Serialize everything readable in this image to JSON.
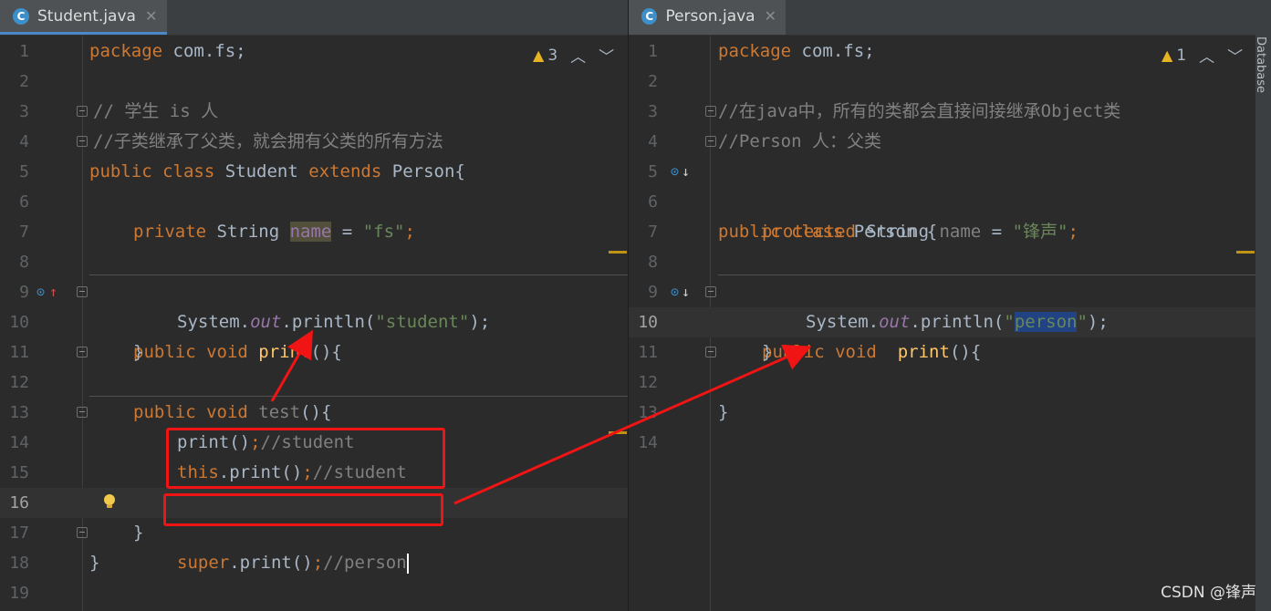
{
  "left": {
    "tab_label": "Student.java",
    "tab_icon": "C",
    "close_symbol": "✕",
    "warnings_count": "3",
    "lines": [
      "1",
      "2",
      "3",
      "4",
      "5",
      "6",
      "7",
      "8",
      "9",
      "10",
      "11",
      "12",
      "13",
      "14",
      "15",
      "16",
      "17",
      "18",
      "19"
    ],
    "code": {
      "l1_kw": "package",
      "l1_rest": " com.fs;",
      "l3": "// 学生 is 人",
      "l4": "//子类继承了父类，就会拥有父类的所有方法",
      "l5_kw1": "public class",
      "l5_name": " Student ",
      "l5_kw2": "extends",
      "l5_rest": " Person{",
      "l7_kw": "private",
      "l7_type": " String ",
      "l7_field": "name",
      "l7_eq": " = ",
      "l7_str": "\"fs\"",
      "l7_semi": ";",
      "l9_kw": "public void",
      "l9_fn": "print",
      "l9_rest": "(){",
      "l10_a": "System.",
      "l10_out": "out",
      "l10_b": ".println(",
      "l10_str": "\"student\"",
      "l10_c": ");",
      "l11": "}",
      "l13_kw": "public void",
      "l13_fn": "test",
      "l13_rest": "(){",
      "l14_code": "print()",
      "l14_semi": ";",
      "l14_cm": "//student",
      "l15_kw": "this",
      "l15_code": ".print()",
      "l15_semi": ";",
      "l15_cm": "//student",
      "l16_kw": "super",
      "l16_code": ".print()",
      "l16_semi": ";",
      "l16_cm": "//person",
      "l17": "}",
      "l18": "}"
    }
  },
  "right": {
    "tab_label": "Person.java",
    "tab_icon": "C",
    "close_symbol": "✕",
    "warnings_count": "1",
    "lines": [
      "1",
      "2",
      "3",
      "4",
      "5",
      "6",
      "7",
      "8",
      "9",
      "10",
      "11",
      "12",
      "13",
      "14"
    ],
    "code": {
      "l1_kw": "package",
      "l1_rest": " com.fs;",
      "l3": "//在java中，所有的类都会直接间接继承Object类",
      "l4": "//Person 人：父类",
      "l5_kw": "public class",
      "l5_rest": " Person {",
      "l7_kw": "protected",
      "l7_type": " String ",
      "l7_field": "name",
      "l7_eq": " = ",
      "l7_str": "\"锋声\"",
      "l7_semi": ";",
      "l9_kw": "public void",
      "l9_fn": "print",
      "l9_rest": "(){",
      "l10_a": "System.",
      "l10_out": "out",
      "l10_b": ".println(",
      "l10_q1": "\"",
      "l10_sel": "person",
      "l10_q2": "\"",
      "l10_c": ");",
      "l11": "}",
      "l13": "}"
    }
  },
  "sidebar": {
    "label": "Database"
  },
  "watermark": "CSDN @锋声",
  "colors": {
    "keyword": "#cc7832",
    "string": "#6a8759",
    "comment": "#808080",
    "annotation_red": "#f01414"
  }
}
